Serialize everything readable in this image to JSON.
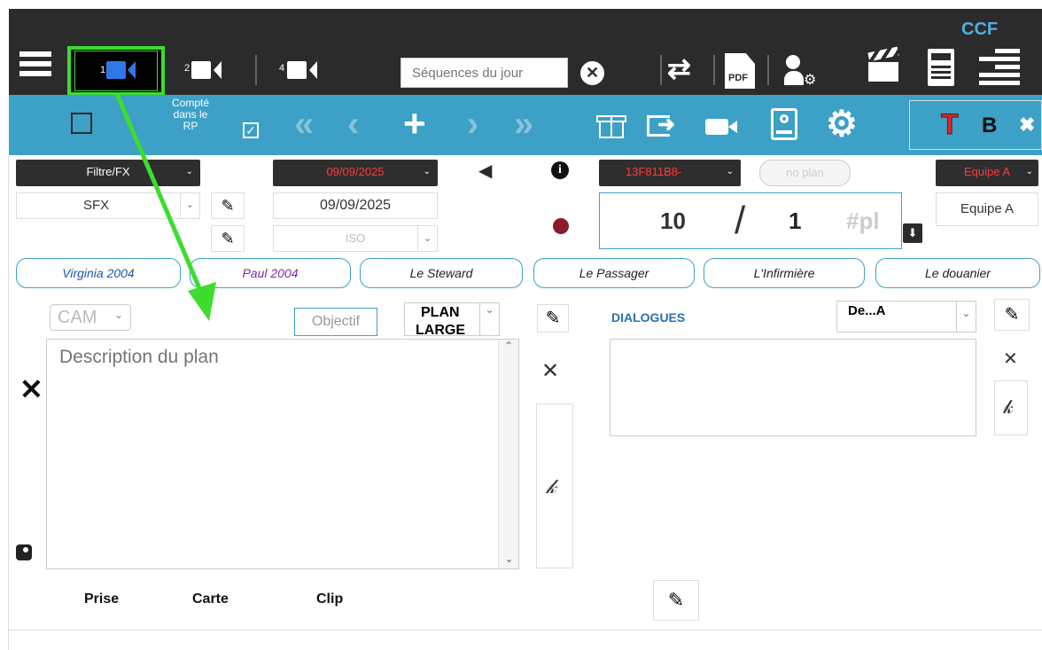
{
  "app": {
    "brand": "CCF"
  },
  "topbar": {
    "cams": [
      {
        "num": "1",
        "selected": true
      },
      {
        "num": "2",
        "selected": false
      },
      {
        "num": "4",
        "selected": false
      }
    ],
    "search": {
      "placeholder": "Séquences du jour",
      "value": ""
    },
    "icons": [
      "menu-icon",
      "clear-search-icon",
      "swap-icon",
      "pdf-icon",
      "user-settings-icon",
      "clapperboard-icon",
      "calculator-icon",
      "list-menu-icon"
    ]
  },
  "toolbar": {
    "compte_label": "Compté dans le RP",
    "compte_checked": true,
    "format": {
      "t": "T",
      "b": "B",
      "x": "✖"
    }
  },
  "form": {
    "filter_select": "Filtre/FX",
    "date_select": "09/09/2025",
    "date_value": "09/09/2025",
    "iso_select": "ISO",
    "sfx_select": "SFX",
    "code_select": "13F811B8-",
    "no_plan": "no plan",
    "team_select": "Equipe A",
    "team_value": "Equipe A",
    "counter": {
      "num": "10",
      "sep": "/",
      "den": "1",
      "suffix": "#pl"
    }
  },
  "characters": [
    {
      "name": "Virginia 2004",
      "color": "#2255aa"
    },
    {
      "name": "Paul 2004",
      "color": "#7a2aa8"
    },
    {
      "name": "Le Steward",
      "color": "#222222"
    },
    {
      "name": "Le Passager",
      "color": "#222222"
    },
    {
      "name": "L'Infirmière",
      "color": "#222222"
    },
    {
      "name": "Le douanier",
      "color": "#222222"
    }
  ],
  "plan": {
    "cam_select": "CAM",
    "objectif": "Objectif",
    "plan_select_line1": "PLAN",
    "plan_select_line2": "LARGE",
    "description_placeholder": "Description du plan",
    "description_value": ""
  },
  "dialogues": {
    "label": "DIALOGUES",
    "speaker_select": "De...A",
    "value": ""
  },
  "bottom": {
    "prise": "Prise",
    "carte": "Carte",
    "clip": "Clip"
  },
  "colors": {
    "accent": "#3da0c6",
    "dark": "#2b2b2b",
    "highlight": "#3ddc2e",
    "red_text": "#e02020",
    "record": "#8b1a2b"
  }
}
